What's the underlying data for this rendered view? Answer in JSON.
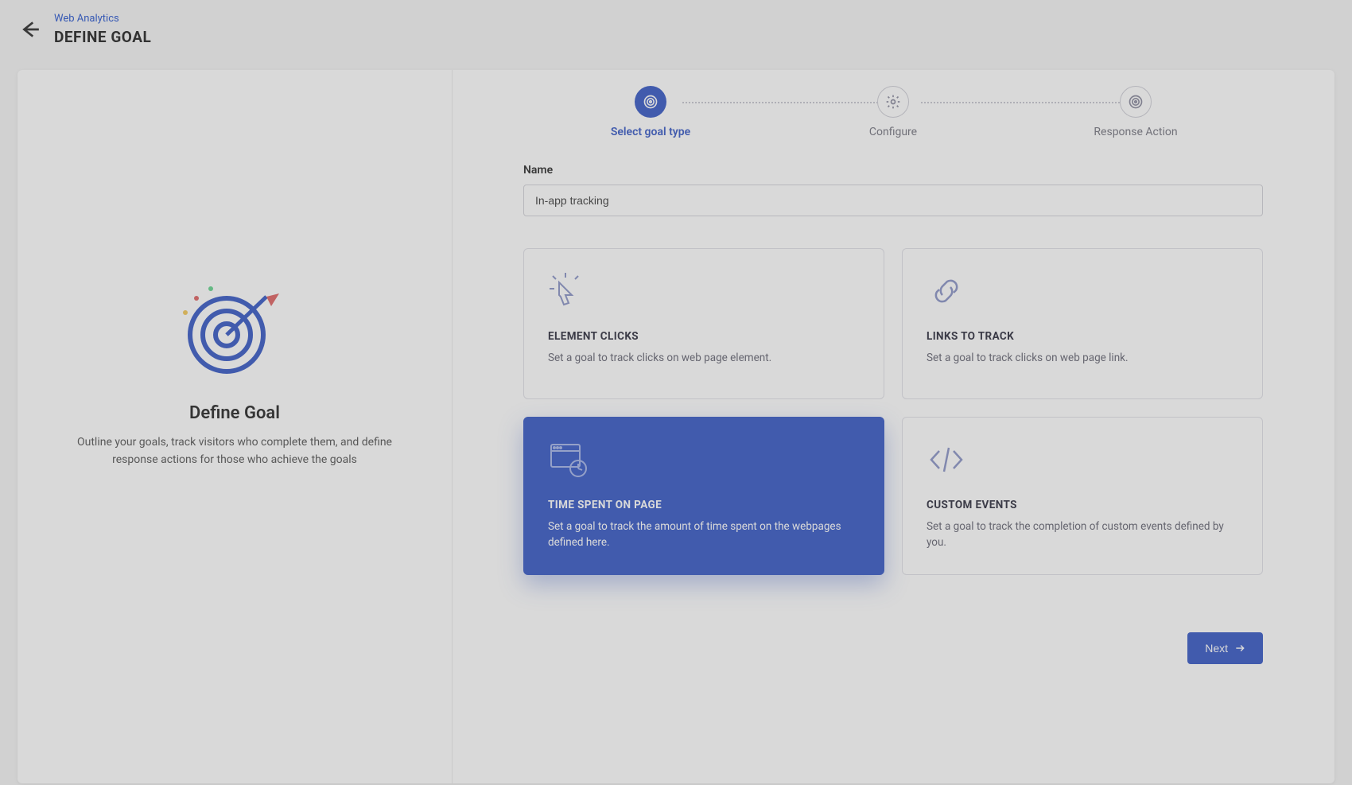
{
  "header": {
    "breadcrumb": "Web Analytics",
    "title": "DEFINE GOAL"
  },
  "left": {
    "title": "Define Goal",
    "description": "Outline your goals, track visitors who complete them, and define response actions for those who achieve the goals"
  },
  "stepper": {
    "steps": [
      {
        "label": "Select goal type",
        "icon": "target-icon",
        "active": true
      },
      {
        "label": "Configure",
        "icon": "gear-icon",
        "active": false
      },
      {
        "label": "Response Action",
        "icon": "target-icon",
        "active": false
      }
    ]
  },
  "form": {
    "name_label": "Name",
    "name_value": "In-app tracking"
  },
  "goal_types": [
    {
      "id": "element-clicks",
      "title": "ELEMENT CLICKS",
      "description": "Set a goal to track clicks on web page element.",
      "icon": "cursor-click-icon",
      "selected": false
    },
    {
      "id": "links-to-track",
      "title": "LINKS TO TRACK",
      "description": "Set a goal to track clicks on web page link.",
      "icon": "link-icon",
      "selected": false
    },
    {
      "id": "time-spent",
      "title": "TIME SPENT ON PAGE",
      "description": "Set a goal to track the amount of time spent on the webpages defined here.",
      "icon": "page-clock-icon",
      "selected": true
    },
    {
      "id": "custom-events",
      "title": "CUSTOM EVENTS",
      "description": "Set a goal to track the completion of custom events defined by you.",
      "icon": "code-icon",
      "selected": false
    }
  ],
  "actions": {
    "next": "Next"
  },
  "colors": {
    "accent": "#3d5ec7"
  }
}
